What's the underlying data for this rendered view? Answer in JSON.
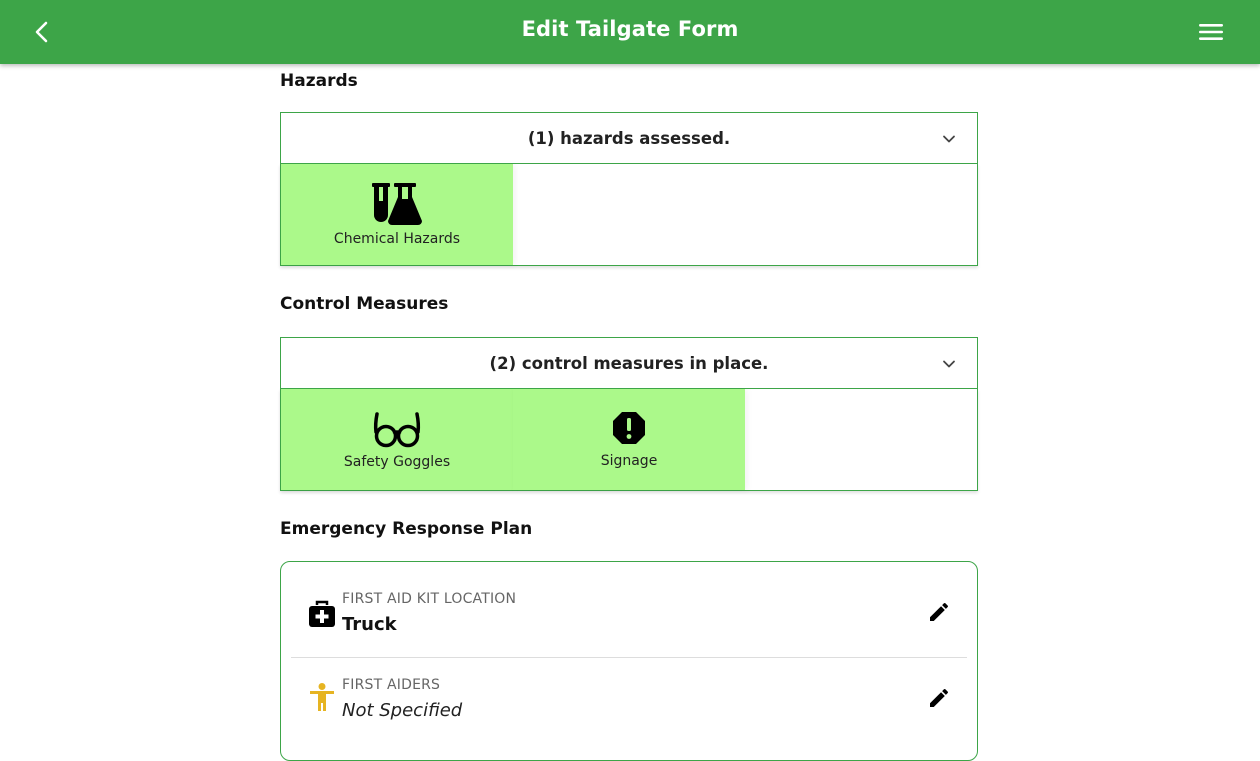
{
  "appbar": {
    "title": "Edit Tailgate Form",
    "color": "#3da548",
    "back_icon": "chevron-left-icon",
    "menu_icon": "hamburger-menu-icon"
  },
  "hazards": {
    "heading": "Hazards",
    "summary": "(1) hazards assessed.",
    "items": [
      {
        "label": "Chemical Hazards",
        "icon": "chemical-flask-icon"
      }
    ]
  },
  "control_measures": {
    "heading": "Control Measures",
    "summary": "(2) control measures in place.",
    "items": [
      {
        "label": "Safety Goggles",
        "icon": "goggles-icon"
      },
      {
        "label": "Signage",
        "icon": "warning-octagon-icon"
      }
    ]
  },
  "emergency_response": {
    "heading": "Emergency Response Plan",
    "rows": [
      {
        "caption": "FIRST AID KIT LOCATION",
        "value": "Truck",
        "icon": "first-aid-kit-icon"
      },
      {
        "caption": "FIRST AIDERS",
        "value": "Not Specified",
        "icon": "person-icon"
      }
    ]
  },
  "colors": {
    "selected_tile": "#abf98a",
    "accent": "#3da548",
    "first_aider_icon": "#e6b422"
  }
}
